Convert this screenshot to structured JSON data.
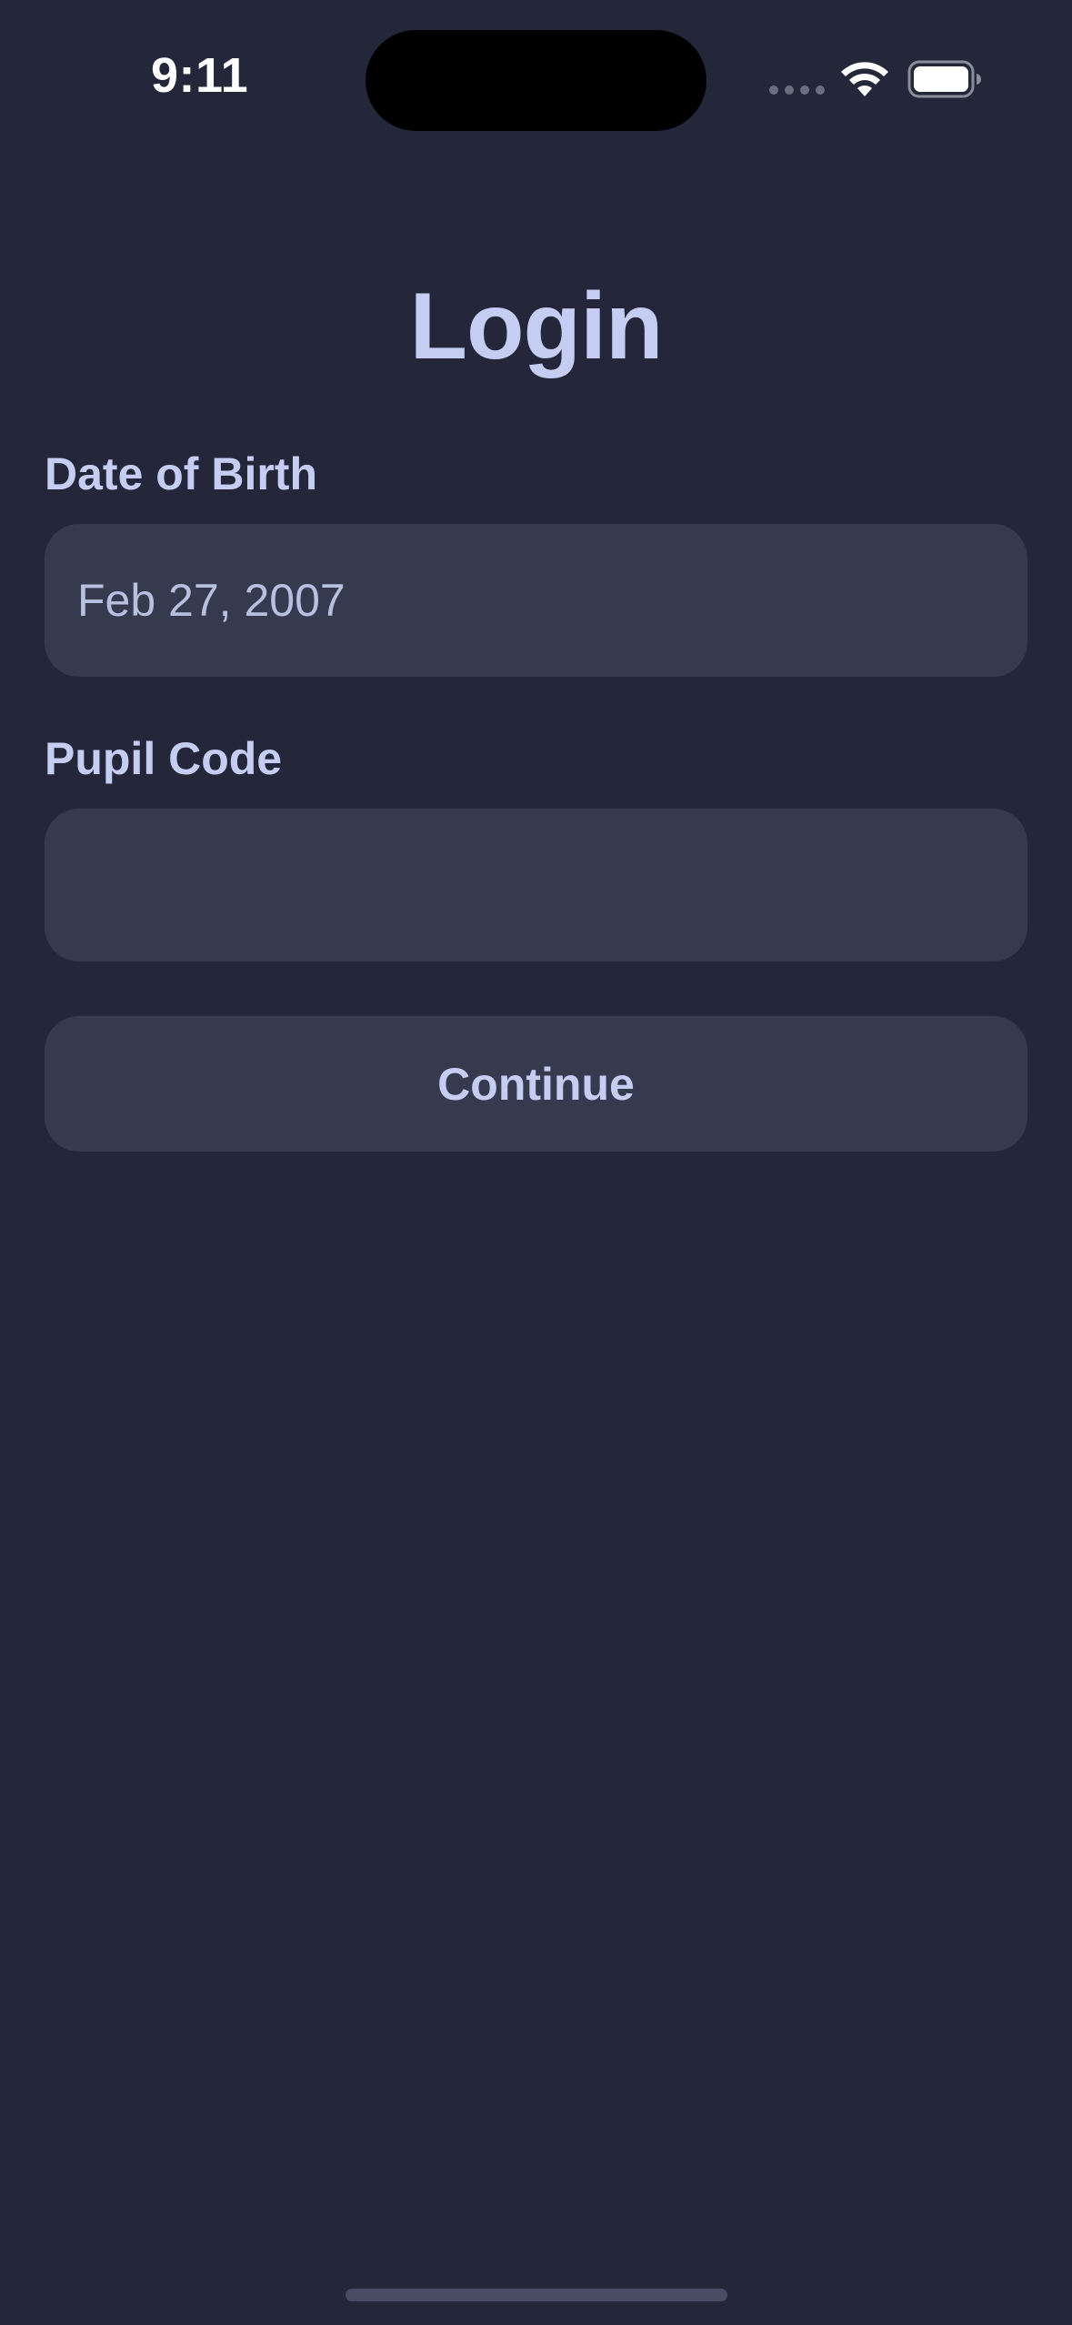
{
  "status_bar": {
    "time": "9:11"
  },
  "login": {
    "title": "Login",
    "dob_label": "Date of Birth",
    "dob_value": "Feb 27, 2007",
    "pupil_code_label": "Pupil Code",
    "pupil_code_value": "",
    "continue_label": "Continue"
  },
  "colors": {
    "background": "#24273a",
    "surface": "#363a4f",
    "text": "#c6cdf3",
    "field_text": "#b8c0e0"
  },
  "icons": [
    "wifi-icon",
    "battery-icon",
    "cellular-signal-icon"
  ]
}
